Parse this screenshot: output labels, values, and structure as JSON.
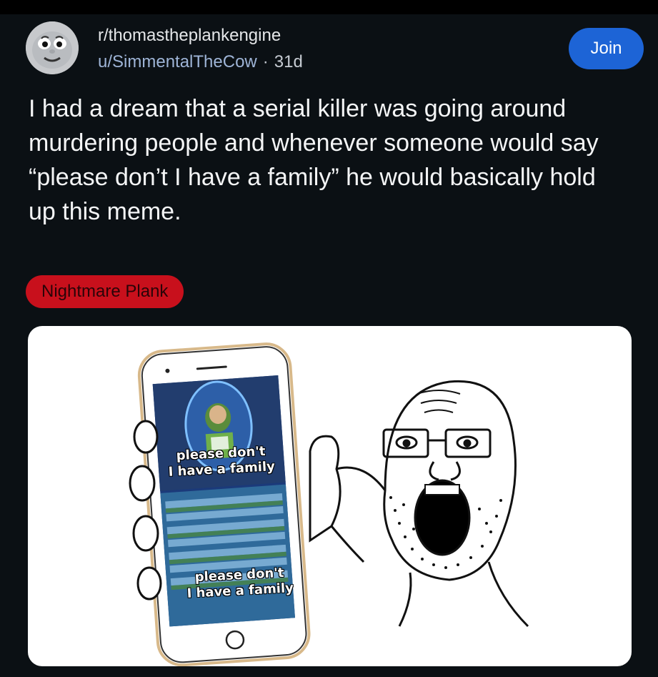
{
  "post": {
    "subreddit": "r/thomastheplankengine",
    "author": "u/SimmentalTheCow",
    "separator": "·",
    "age": "31d",
    "join_label": "Join",
    "title": "I had a dream that a serial killer was going around murdering people and whenever someone would say “please don’t I have a family” he would basically hold up this meme.",
    "flair": "Nightmare Plank"
  },
  "meme": {
    "top_caption_line1": "please don't",
    "top_caption_line2": "I have a family",
    "bottom_caption_line1": "please don't",
    "bottom_caption_line2": "I have a family"
  },
  "colors": {
    "background": "#0b1014",
    "join_button": "#1d64d6",
    "flair": "#c8101c",
    "author": "#9eb4d6"
  },
  "icons": {
    "avatar": "thomas-face-avatar"
  }
}
